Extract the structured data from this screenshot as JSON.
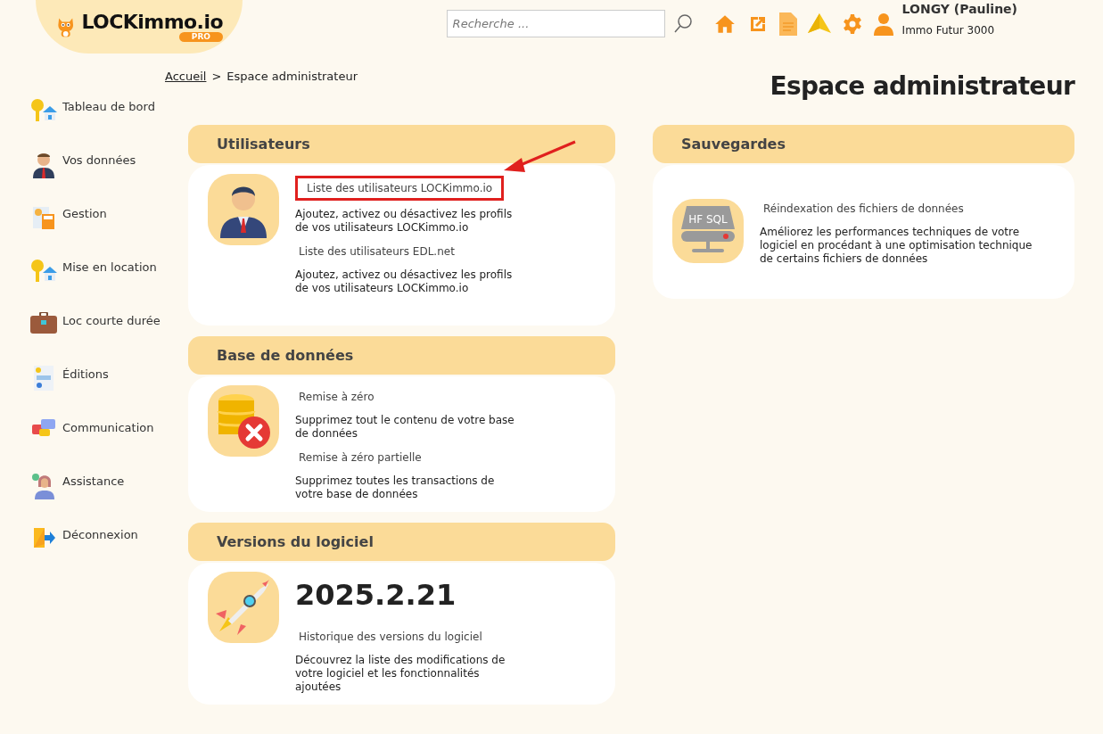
{
  "logo": {
    "name": "LOCKimmo.io",
    "badge": "PRO"
  },
  "search": {
    "placeholder": "Recherche ..."
  },
  "user": {
    "name": "LONGY (Pauline)",
    "company": "Immo Futur 3000"
  },
  "breadcrumb": {
    "home": "Accueil",
    "separator": ">",
    "current": "Espace administrateur"
  },
  "page_title": "Espace administrateur",
  "sidebar": {
    "items": [
      {
        "label": "Tableau de bord"
      },
      {
        "label": "Vos données"
      },
      {
        "label": "Gestion"
      },
      {
        "label": "Mise en location"
      },
      {
        "label": "Loc courte durée"
      },
      {
        "label": "Éditions"
      },
      {
        "label": "Communication"
      },
      {
        "label": "Assistance"
      },
      {
        "label": "Déconnexion"
      }
    ]
  },
  "left_sections": [
    {
      "kind": "users",
      "title": "Utilisateurs",
      "links": [
        {
          "label": "Liste des utilisateurs LOCKimmo.io",
          "description": "Ajoutez, activez ou désactivez les profils de vos utilisateurs LOCKimmo.io",
          "highlighted": true
        },
        {
          "label": "Liste des utilisateurs EDL.net",
          "description": "Ajoutez, activez ou désactivez les profils de vos utilisateurs LOCKimmo.io",
          "highlighted": false
        }
      ]
    },
    {
      "kind": "database",
      "title": "Base de données",
      "links": [
        {
          "label": "Remise à zéro",
          "description": "Supprimez tout le contenu de votre base de données",
          "highlighted": false
        },
        {
          "label": "Remise à zéro partielle",
          "description": "Supprimez toutes les transactions de votre base de données",
          "highlighted": false
        }
      ]
    },
    {
      "kind": "versions",
      "title": "Versions du logiciel",
      "version": "2025.2.21",
      "links": [
        {
          "label": "Historique des versions du logiciel",
          "description": "Découvrez la liste des modifications de votre logiciel et les fonctionnalités ajoutées",
          "highlighted": false
        }
      ]
    }
  ],
  "right_sections": [
    {
      "kind": "server",
      "title": "Sauvegardes",
      "icon_text": "HF SQL",
      "links": [
        {
          "label": "Réindexation des fichiers de données",
          "description": "Améliorez les performances techniques de votre logiciel en procédant à une optimisation technique de certains fichiers de données",
          "highlighted": false
        }
      ]
    }
  ]
}
